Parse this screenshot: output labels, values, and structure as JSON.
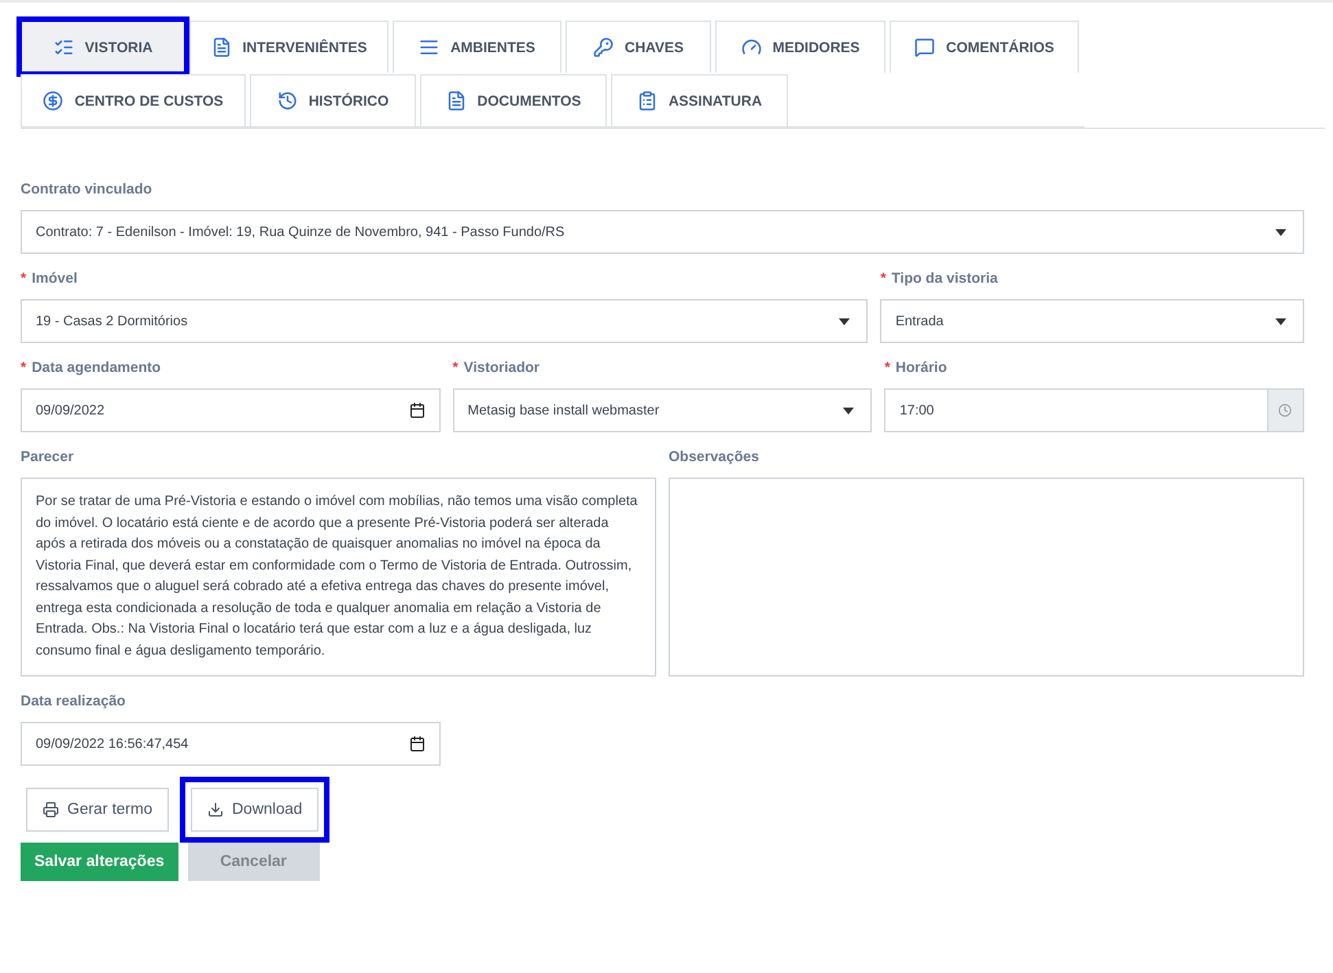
{
  "tabs": [
    {
      "label": "VISTORIA",
      "selected": true,
      "highlighted": true
    },
    {
      "label": "INTERVENIÊNTES",
      "selected": false,
      "highlighted": false
    },
    {
      "label": "AMBIENTES",
      "selected": false,
      "highlighted": false
    },
    {
      "label": "CHAVES",
      "selected": false,
      "highlighted": false
    },
    {
      "label": "MEDIDORES",
      "selected": false,
      "highlighted": false
    },
    {
      "label": "COMENTÁRIOS",
      "selected": false,
      "highlighted": false
    },
    {
      "label": "CENTRO DE CUSTOS",
      "selected": false,
      "highlighted": false
    },
    {
      "label": "HISTÓRICO",
      "selected": false,
      "highlighted": false
    },
    {
      "label": "DOCUMENTOS",
      "selected": false,
      "highlighted": false
    },
    {
      "label": "ASSINATURA",
      "selected": false,
      "highlighted": false
    }
  ],
  "rows": [
    [
      {
        "label": "Contrato vinculado",
        "kind": "select",
        "value": "Contrato: 7 - Edenilson - Imóvel: 19, Rua Quinze de Novembro, 941 - Passo Fundo/RS"
      }
    ],
    [
      {
        "label": "Imóvel",
        "required_mark": "*",
        "kind": "select",
        "value": "19 - Casas 2 Dormitórios"
      },
      {
        "label": "Tipo da vistoria",
        "required_mark": "*",
        "kind": "select",
        "value": "Entrada"
      }
    ],
    [
      {
        "label": "Data agendamento",
        "required_mark": "*",
        "kind": "date",
        "value": "09/09/2022"
      },
      {
        "label": "Vistoriador",
        "required_mark": "*",
        "kind": "select",
        "value": "Metasig base install webmaster"
      },
      {
        "label": "Horário",
        "required_mark": "*",
        "kind": "time",
        "value": "17:00"
      }
    ],
    [
      {
        "label": "Parecer",
        "kind": "textarea",
        "value": "Por se tratar de uma Pré-Vistoria e estando o imóvel com mobílias, não temos uma visão completa do imóvel. O locatário está ciente e de acordo que a presente Pré-Vistoria poderá ser alterada após a retirada dos móveis ou a constatação de quaisquer anomalias no imóvel na época da Vistoria Final, que deverá estar em conformidade com o Termo de Vistoria de Entrada. Outrossim, ressalvamos que o aluguel será cobrado até a efetiva entrega das chaves do presente imóvel, entrega esta condicionada a resolução de toda e qualquer anomalia em relação a Vistoria de Entrada. Obs.: Na Vistoria Final o locatário terá que estar com a luz e a água desligada, luz consumo final e água desligamento temporário."
      },
      {
        "label": "Observações",
        "kind": "textarea"
      }
    ],
    [
      {
        "label": "Data realização",
        "kind": "date",
        "value": "09/09/2022 16:56:47,454"
      }
    ]
  ],
  "tools": [
    {
      "label": "Gerar termo",
      "highlighted": false
    },
    {
      "label": "Download",
      "highlighted": true
    }
  ],
  "actions": [
    {
      "label": "Salvar alterações",
      "disabled": false
    },
    {
      "label": "Cancelar",
      "disabled": true
    }
  ]
}
